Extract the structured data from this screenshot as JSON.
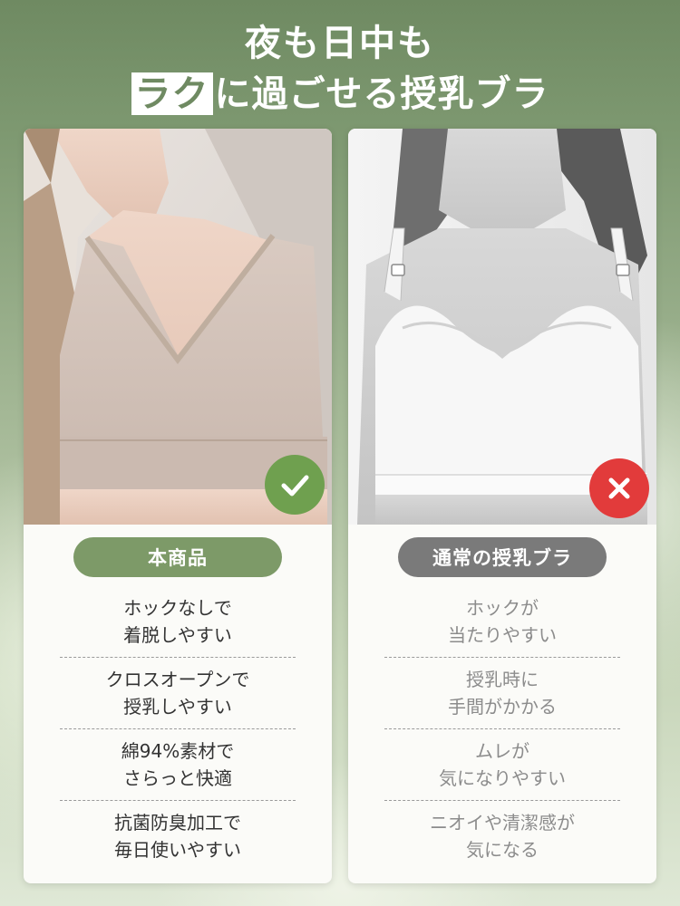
{
  "heading": {
    "line1": "夜も日中も",
    "line2_highlight": "ラク",
    "line2_rest": "に過ごせる授乳ブラ"
  },
  "left_card": {
    "badge": "本商品",
    "mark_icon": "check-icon",
    "items": [
      {
        "line1": "ホックなしで",
        "line2": "着脱しやすい"
      },
      {
        "line1": "クロスオープンで",
        "line2": "授乳しやすい"
      },
      {
        "line1": "綿94%素材で",
        "line2": "さらっと快適"
      },
      {
        "line1": "抗菌防臭加工で",
        "line2": "毎日使いやすい"
      }
    ]
  },
  "right_card": {
    "badge": "通常の授乳ブラ",
    "mark_icon": "cross-icon",
    "items": [
      {
        "line1": "ホックが",
        "line2": "当たりやすい"
      },
      {
        "line1": "授乳時に",
        "line2": "手間がかかる"
      },
      {
        "line1": "ムレが",
        "line2": "気になりやすい"
      },
      {
        "line1": "ニオイや清潔感が",
        "line2": "気になる"
      }
    ]
  },
  "colors": {
    "brand_green": "#7d9a68",
    "check_green": "#6fa04f",
    "cross_red": "#e23b3b",
    "neutral_gray": "#7a7a7a"
  }
}
